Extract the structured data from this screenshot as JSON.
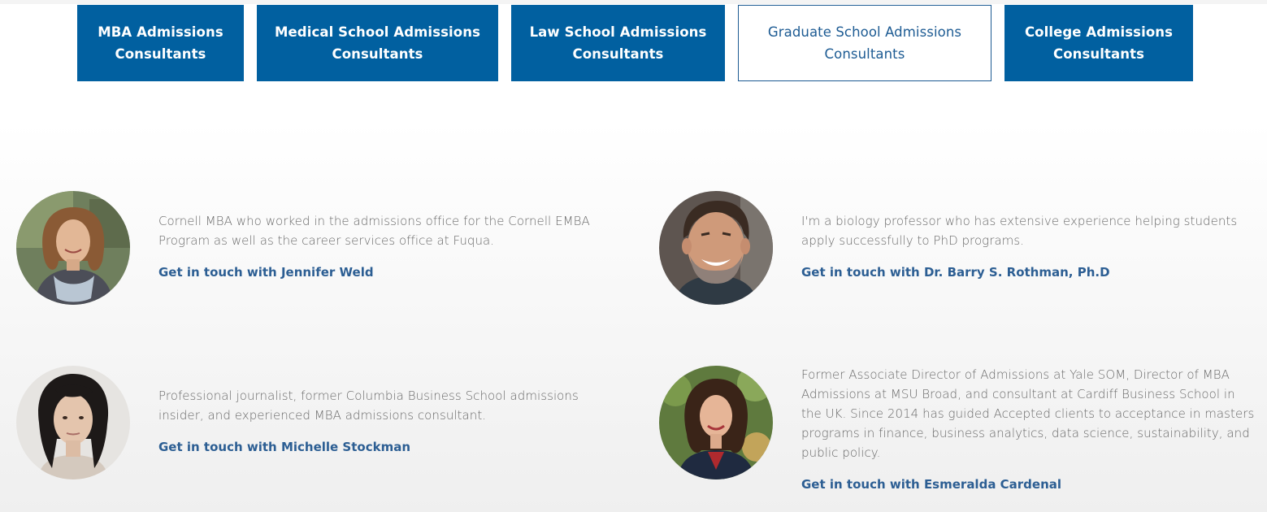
{
  "tabs": [
    {
      "line1": "MBA Admissions",
      "line2": "Consultants",
      "active": false
    },
    {
      "line1": "Medical School Admissions",
      "line2": "Consultants",
      "active": false
    },
    {
      "line1": "Law School Admissions",
      "line2": "Consultants",
      "active": false
    },
    {
      "line1": "Graduate School Admissions",
      "line2": "Consultants",
      "active": true
    },
    {
      "line1": "College Admissions",
      "line2": "Consultants",
      "active": false
    }
  ],
  "consultants": [
    {
      "bio": "Cornell MBA who worked in the admissions office for the Cornell EMBA Program as well as the career services office at Fuqua.",
      "link": "Get in touch with Jennifer Weld"
    },
    {
      "bio": "I'm a biology professor who has extensive experience helping students apply successfully to PhD programs.",
      "link": "Get in touch with Dr. Barry S. Rothman, Ph.D"
    },
    {
      "bio": "Professional journalist, former Columbia Business School admissions insider, and experienced MBA admissions consultant.",
      "link": "Get in touch with Michelle Stockman"
    },
    {
      "bio": "Former Associate Director of Admissions at Yale SOM, Director of MBA Admissions at MSU Broad, and consultant at Cardiff Business School in the UK. Since 2014 has guided Accepted clients to acceptance in masters programs in finance, business analytics, data science, sustainability, and public policy.",
      "link": "Get in touch with Esmeralda Cardenal"
    }
  ],
  "colors": {
    "brand_blue": "#0160a0",
    "link_blue": "#2c5e93",
    "text_gray": "#6a6a6a"
  }
}
